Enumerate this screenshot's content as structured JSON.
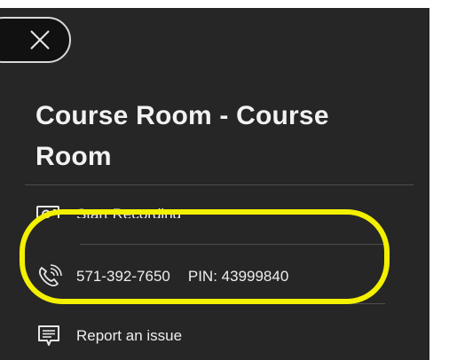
{
  "panel": {
    "title": "Course Room - Course Room",
    "close_icon": "close-icon"
  },
  "menu": {
    "recording": {
      "label": "Start Recording",
      "icon": "record-camera-icon"
    },
    "phone": {
      "number": "571-392-7650",
      "pin": "PIN: 43999840",
      "icon": "phone-icon"
    },
    "issue": {
      "label": "Report an issue",
      "icon": "feedback-icon"
    }
  },
  "colors": {
    "panel_background": "#262626",
    "text": "#eeeeee",
    "highlight": "#f3f000"
  }
}
